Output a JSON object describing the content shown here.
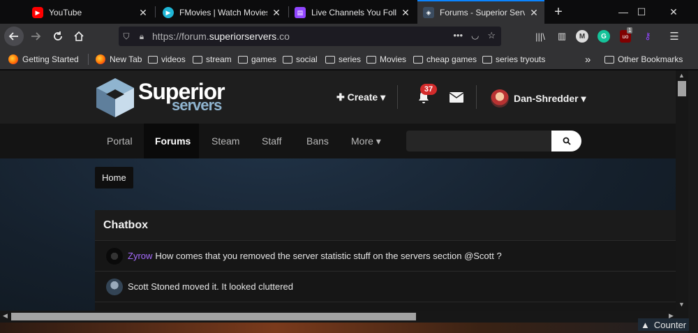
{
  "browser": {
    "tabs": [
      {
        "title": "YouTube",
        "icon": "youtube-icon",
        "color": "#ff0000"
      },
      {
        "title": "FMovies | Watch Movies",
        "icon": "fmovies-icon",
        "color": "#1fb6d6"
      },
      {
        "title": "Live Channels You Follow",
        "icon": "twitch-icon",
        "color": "#9146ff"
      },
      {
        "title": "Forums - Superior Serve",
        "icon": "superior-servers-icon",
        "color": "#6d8fb0"
      }
    ],
    "url_prefix": "https://forum.",
    "url_domain": "superiorservers",
    "url_suffix": ".co",
    "ublock_count": "1",
    "bookmarks": [
      {
        "label": "Getting Started",
        "icon": "firefox-icon"
      },
      {
        "label": "New Tab",
        "icon": "firefox-icon"
      },
      {
        "label": "videos",
        "icon": "folder-icon"
      },
      {
        "label": "stream",
        "icon": "folder-icon"
      },
      {
        "label": "games",
        "icon": "folder-icon"
      },
      {
        "label": "social",
        "icon": "folder-icon"
      },
      {
        "label": "series",
        "icon": "folder-icon"
      },
      {
        "label": "Movies",
        "icon": "folder-icon"
      },
      {
        "label": "cheap games",
        "icon": "folder-icon"
      },
      {
        "label": "series tryouts",
        "icon": "folder-icon"
      }
    ],
    "overflow_label": "»",
    "other_bookmarks": "Other Bookmarks"
  },
  "site": {
    "logo_line1": "Superior",
    "logo_line2": "servers",
    "create_label": "Create",
    "notification_count": "37",
    "username": "Dan-Shredder",
    "nav": [
      "Portal",
      "Forums",
      "Steam",
      "Staff",
      "Bans",
      "More"
    ],
    "active_nav": "Forums",
    "breadcrumb": "Home",
    "chatbox_title": "Chatbox",
    "messages": [
      {
        "user": "Zyrow",
        "text": "How comes that you removed the server statistic stuff on the servers section @Scott ?",
        "user_color": "#a66cff"
      },
      {
        "user": "",
        "text": "Scott Stoned moved it. It looked cluttered",
        "user_color": ""
      }
    ]
  },
  "taskbar": {
    "counter_label": "Counter"
  },
  "colors": {
    "accent": "#0a84ff",
    "badge": "#d32b2b"
  }
}
